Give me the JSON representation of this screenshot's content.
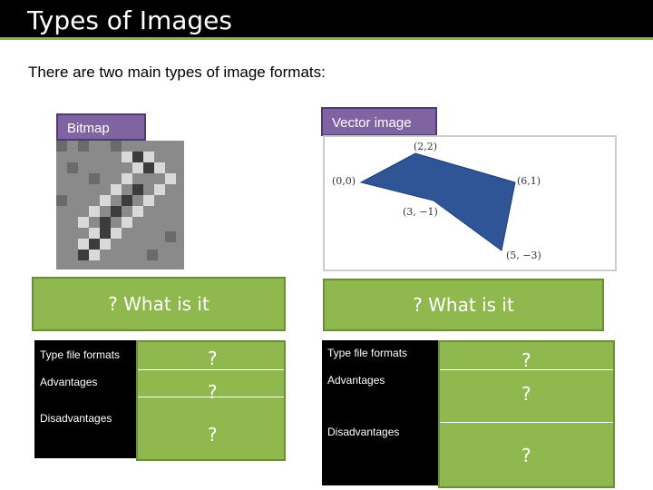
{
  "title": "Types of Images",
  "intro": "There are two main types of image formats:",
  "bitmap": {
    "label": "Bitmap"
  },
  "vector": {
    "label": "Vector image",
    "points": {
      "p1": "(2,2)",
      "p2": "(0,0)",
      "p3": "(6,1)",
      "p4": "(3, −1)",
      "p5": "(5, −3)"
    },
    "fill_color": "#2f5597"
  },
  "left": {
    "what": "? What is it",
    "rows": [
      "Type file formats",
      "Advantages",
      "Disadvantages"
    ],
    "answers": [
      "?",
      "?",
      "?"
    ]
  },
  "right": {
    "what": "? What is it",
    "rows": [
      "Type file formats",
      "Advantages",
      "Disadvantages"
    ],
    "answers": [
      "?",
      "?",
      "?"
    ]
  },
  "colors": {
    "accent_green": "#8fb94f",
    "label_purple": "#8064a2",
    "title_bg": "#000000"
  }
}
